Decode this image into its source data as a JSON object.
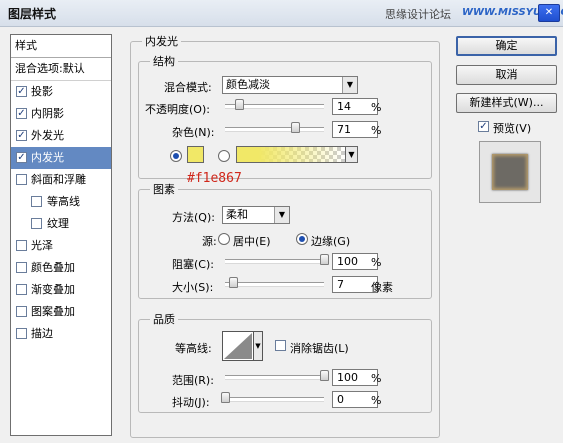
{
  "window": {
    "title": "图层样式",
    "watermark": "思缘设计论坛",
    "watermark_site": "WWW.MISSYUAN.COM",
    "close_glyph": "✕"
  },
  "styles_panel": {
    "header": "样式",
    "blend_options": "混合选项:默认",
    "items": [
      {
        "label": "投影",
        "checked": true
      },
      {
        "label": "内阴影",
        "checked": true
      },
      {
        "label": "外发光",
        "checked": true
      },
      {
        "label": "内发光",
        "checked": true,
        "selected": true
      },
      {
        "label": "斜面和浮雕",
        "checked": false
      },
      {
        "label": "等高线",
        "checked": false,
        "sub": true
      },
      {
        "label": "纹理",
        "checked": false,
        "sub": true
      },
      {
        "label": "光泽",
        "checked": false
      },
      {
        "label": "颜色叠加",
        "checked": false
      },
      {
        "label": "渐变叠加",
        "checked": false
      },
      {
        "label": "图案叠加",
        "checked": false
      },
      {
        "label": "描边",
        "checked": false
      }
    ]
  },
  "inner_glow": {
    "title": "内发光",
    "structure": {
      "title": "结构",
      "blend_mode_label": "混合模式:",
      "blend_mode_value": "颜色减淡",
      "opacity_label": "不透明度(O):",
      "opacity_value": "14",
      "opacity_level": 14,
      "noise_label": "杂色(N):",
      "noise_value": "71",
      "noise_level": 71,
      "percent": "%",
      "color_swatch": "#f1e867",
      "color_annotation": "#f1e867"
    },
    "elements": {
      "title": "图素",
      "technique_label": "方法(Q):",
      "technique_value": "柔和",
      "source_label": "源:",
      "source_center": "居中(E)",
      "source_edge": "边缘(G)",
      "choke_label": "阻塞(C):",
      "choke_value": "100",
      "choke_level": 100,
      "size_label": "大小(S):",
      "size_value": "7",
      "size_unit": "像素",
      "percent": "%"
    },
    "quality": {
      "title": "品质",
      "contour_label": "等高线:",
      "anti_alias_label": "消除锯齿(L)",
      "range_label": "范围(R):",
      "range_value": "100",
      "range_level": 100,
      "jitter_label": "抖动(J):",
      "jitter_value": "0",
      "jitter_level": 0,
      "percent": "%"
    }
  },
  "buttons": {
    "ok": "确定",
    "cancel": "取消",
    "new_style": "新建样式(W)...",
    "preview_label": "预览(V)"
  }
}
